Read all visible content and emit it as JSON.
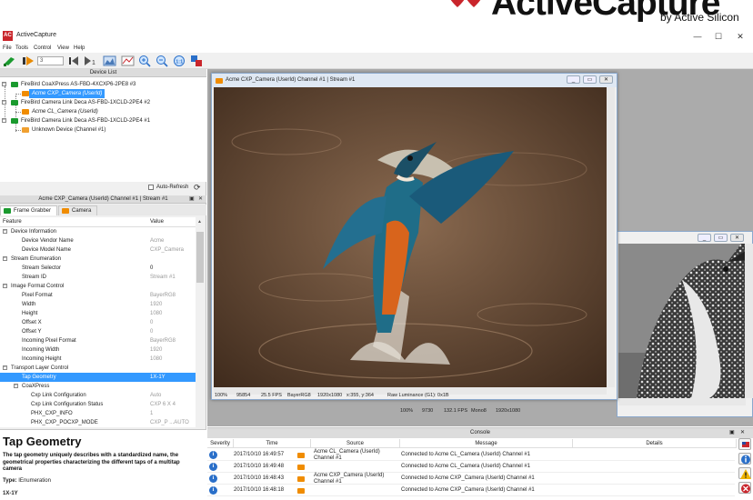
{
  "logo": {
    "brand": "ActiveCapture",
    "byline": "by Active Silicon"
  },
  "window": {
    "icon_text": "AC",
    "title": "ActiveCapture",
    "min": "—",
    "max": "☐",
    "close": "✕"
  },
  "menu": [
    "File",
    "Tools",
    "Control",
    "View",
    "Help"
  ],
  "toolbar": {
    "frame_count": "3"
  },
  "device_list": {
    "title": "Device List",
    "items": [
      "FireBird CoaXPress AS-FBD-4XCXP6-2PE8 #3",
      "Acme CXP_Camera (UserId)",
      "FireBird Camera Link Deca AS-FBD-1XCLD-2PE4 #2",
      "Acme CL_Camera (UserId)",
      "FireBird Camera Link Deca AS-FBD-1XCLD-2PE4 #1",
      "Unknown Device (Channel #1)"
    ],
    "auto_refresh": "Auto-Refresh"
  },
  "properties": {
    "title": "Acme CXP_Camera (UserId) Channel #1 | Stream #1",
    "tabs": [
      "Frame Grabber",
      "Camera"
    ],
    "col_feature": "Feature",
    "col_value": "Value",
    "rows": [
      {
        "name": "Device Information",
        "value": "",
        "level": 0
      },
      {
        "name": "Device Vendor Name",
        "value": "Acme",
        "level": 1
      },
      {
        "name": "Device Model Name",
        "value": "CXP_Camera",
        "level": 1
      },
      {
        "name": "Stream Enumeration",
        "value": "",
        "level": 0
      },
      {
        "name": "Stream Selector",
        "value": "0",
        "level": 1
      },
      {
        "name": "Stream ID",
        "value": "Stream #1",
        "level": 1
      },
      {
        "name": "Image Format Control",
        "value": "",
        "level": 0
      },
      {
        "name": "Pixel Format",
        "value": "BayerRG8",
        "level": 1
      },
      {
        "name": "Width",
        "value": "1920",
        "level": 1
      },
      {
        "name": "Height",
        "value": "1080",
        "level": 1
      },
      {
        "name": "Offset X",
        "value": "0",
        "level": 1
      },
      {
        "name": "Offset Y",
        "value": "0",
        "level": 1
      },
      {
        "name": "Incoming Pixel Format",
        "value": "BayerRG8",
        "level": 1
      },
      {
        "name": "Incoming Width",
        "value": "1920",
        "level": 1
      },
      {
        "name": "Incoming Height",
        "value": "1080",
        "level": 1
      },
      {
        "name": "Transport Layer Control",
        "value": "",
        "level": 0
      },
      {
        "name": "Tap Geometry",
        "value": "1X-1Y",
        "level": 1
      },
      {
        "name": "CoaXPress",
        "value": "",
        "level": 1
      },
      {
        "name": "Cxp Link Configuration",
        "value": "Auto",
        "level": 2
      },
      {
        "name": "Cxp Link Configuration Status",
        "value": "CXP 6 X 4",
        "level": 2
      },
      {
        "name": "PHX_CXP_INFO",
        "value": "1",
        "level": 2
      },
      {
        "name": "PHX_CXP_POCXP_MODE",
        "value": "CXP_P ...AUTO",
        "level": 2
      }
    ]
  },
  "help": {
    "heading": "Tap Geometry",
    "description": "The tap geometry uniquely describes with a standardized name, the geometrical properties characterizing the different taps of a multitap camera",
    "type_label": "Type:",
    "type_value": "IEnumeration",
    "code": "1X-1Y"
  },
  "view1": {
    "title": "Acme CXP_Camera (UserId) Channel #1 | Stream #1",
    "status": [
      "100%",
      "95854",
      "25.5 FPS",
      "BayerRG8",
      "1920x1080",
      "x:355, y:364",
      "Raw Luminance (G1): 0x1B"
    ]
  },
  "view2": {
    "status": [
      "100%",
      "9730",
      "132.1 FPS",
      "Mono8",
      "1920x1080"
    ]
  },
  "console": {
    "title": "Console",
    "columns": [
      "Severity",
      "Time",
      "Source",
      "Message",
      "Details"
    ],
    "rows": [
      {
        "time": "2017/10/10 16:49:57",
        "source": "Acme CL_Camera (UserId) Channel #1",
        "message": "Connected to Acme CL_Camera (UserId) Channel #1"
      },
      {
        "time": "2017/10/10 16:49:48",
        "source": "",
        "message": "Connected to Acme CL_Camera (UserId) Channel #1"
      },
      {
        "time": "2017/10/10 16:48:43",
        "source": "Acme CXP_Camera (UserId) Channel #1",
        "message": "Connected to Acme CXP_Camera (UserId) Channel #1"
      },
      {
        "time": "2017/10/10 16:48:18",
        "source": "",
        "message": "Connected to Acme CXP_Camera (UserId) Channel #1"
      }
    ]
  },
  "colors": {
    "accent": "#c9252b",
    "selection": "#3399ff",
    "grabber_green": "#1a9a2e",
    "camera_orange": "#f08c00"
  }
}
